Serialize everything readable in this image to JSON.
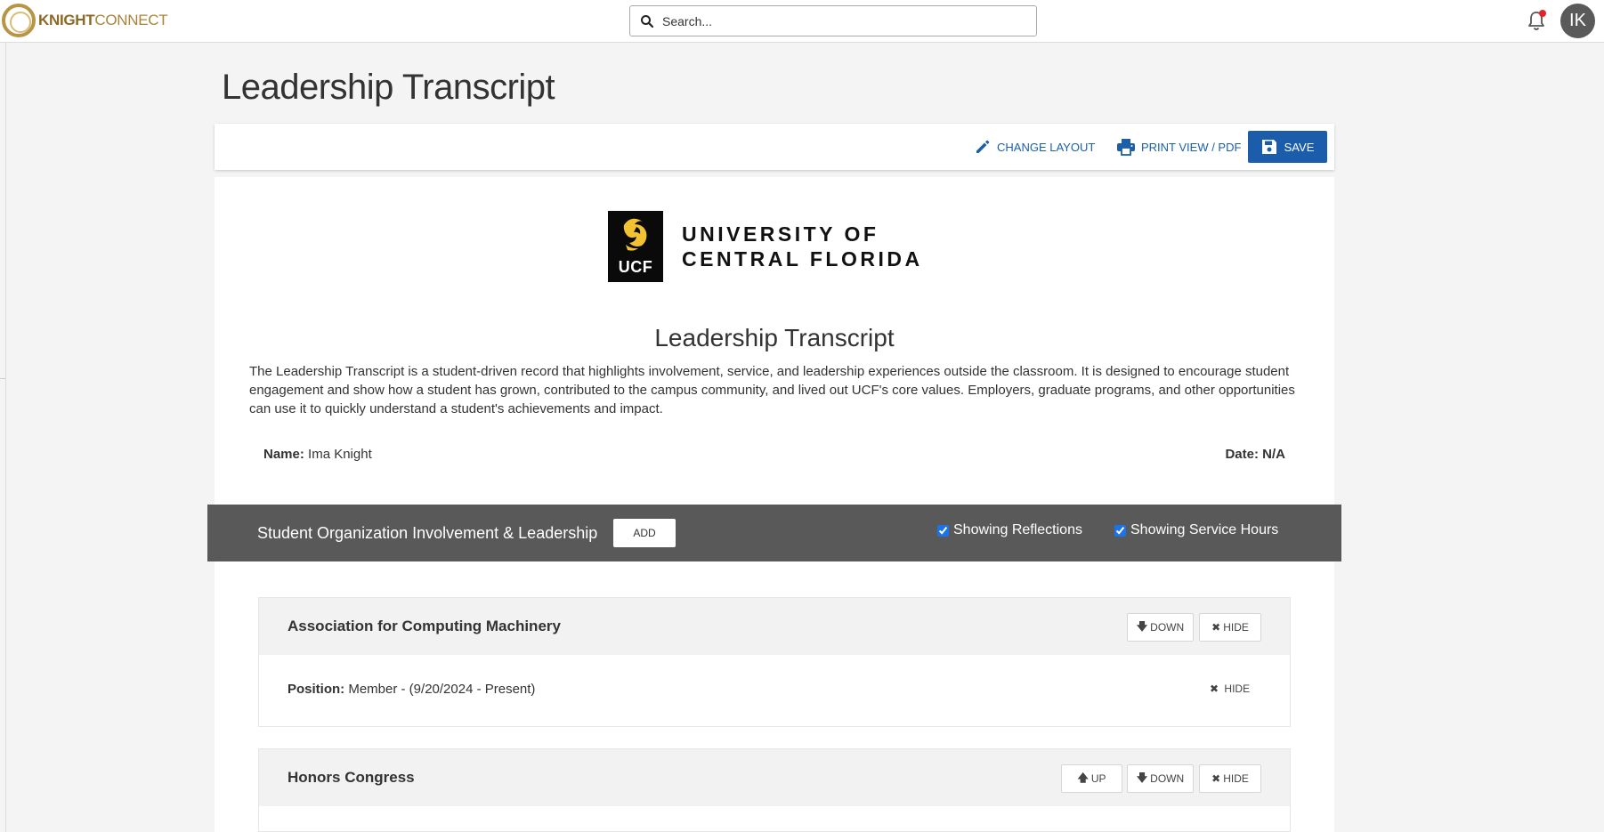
{
  "header": {
    "logo_bold": "KNIGHT",
    "logo_light": "CONNECT",
    "search_placeholder": "Search...",
    "avatar_initials": "IK",
    "notification_dot_color": "#e0242a"
  },
  "page": {
    "title": "Leadership Transcript"
  },
  "toolbar": {
    "change_layout_label": "CHANGE LAYOUT",
    "print_label": "PRINT VIEW / PDF",
    "save_label": "SAVE",
    "accent_color": "#1b5dab"
  },
  "document": {
    "logo_letters": "UCF",
    "university_line1": "UNIVERSITY OF",
    "university_line2": "CENTRAL FLORIDA",
    "title": "Leadership Transcript",
    "description": "The Leadership Transcript is a student-driven record that highlights involvement, service, and leadership experiences outside the classroom. It is designed to encourage student engagement and show how a student has grown, contributed to the campus community, and lived out UCF's core values. Employers, graduate programs, and other opportunities can use it to quickly understand a student's achievements and impact.",
    "name_label": "Name:",
    "name_value": "Ima Knight",
    "date_label": "Date:",
    "date_value": "N/A"
  },
  "section": {
    "title": "Student Organization Involvement & Leadership",
    "add_label": "ADD",
    "reflections_label": "Showing Reflections",
    "reflections_checked": true,
    "service_hours_label": "Showing Service Hours",
    "service_hours_checked": true
  },
  "organizations": [
    {
      "name": "Association for Computing Machinery",
      "down_label": "DOWN",
      "hide_label": "HIDE",
      "position_label": "Position:",
      "position_value": "Member - (9/20/2024 - Present)",
      "position_hide_label": "HIDE"
    },
    {
      "name": "Honors Congress",
      "up_label": "UP",
      "down_label": "DOWN",
      "hide_label": "HIDE"
    }
  ]
}
